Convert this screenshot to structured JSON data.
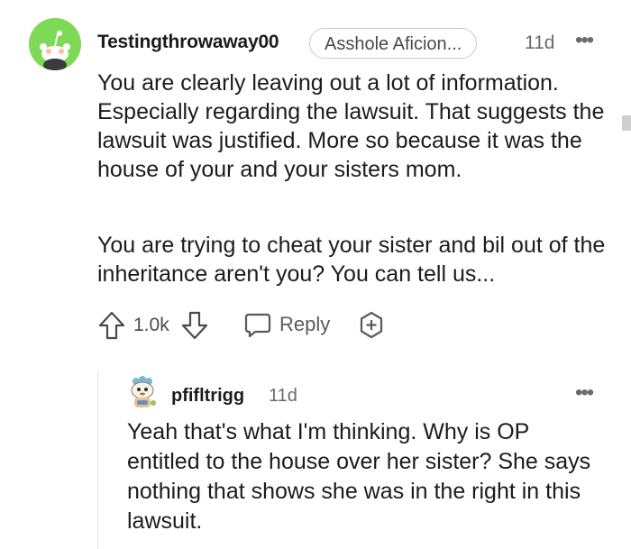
{
  "comment": {
    "username": "Testingthrowaway00",
    "flair": "Asshole Aficion...",
    "time": "11d",
    "more": "•••",
    "paragraphs": [
      "You are clearly leaving out a lot of information. Especially regarding the lawsuit. That suggests the lawsuit was justified. More so because it was the house of your and your sisters mom.",
      "You are trying to cheat your sister and bil out of the inheritance aren't you? You can tell us..."
    ],
    "votes": "1.0k",
    "reply_label": "Reply",
    "avatar_color": "#7ed957"
  },
  "reply": {
    "username": "pfifltrigg",
    "time": "11d",
    "more": "•••",
    "text": "Yeah that's what I'm thinking. Why is OP entitled to the house over her sister? She says nothing that shows she was in the right in this lawsuit."
  },
  "icons": [
    "avatar-snoo-icon",
    "upvote-icon",
    "downvote-icon",
    "reply-bubble-icon",
    "award-icon",
    "more-icon"
  ]
}
